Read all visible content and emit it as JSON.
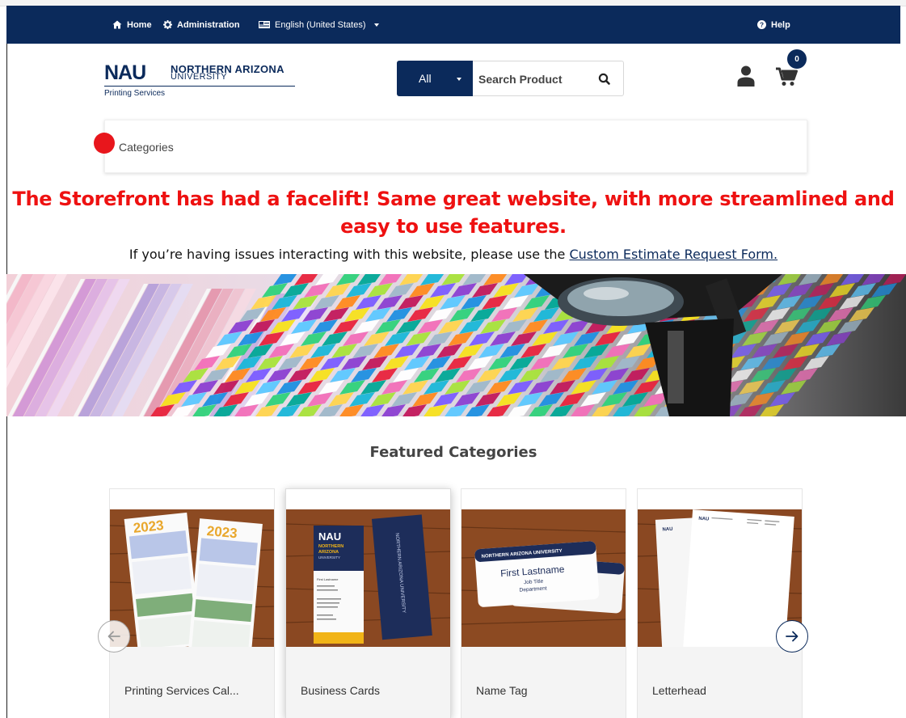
{
  "nav": {
    "home": "Home",
    "administration": "Administration",
    "language": "English (United States)",
    "help": "Help"
  },
  "logo": {
    "mark": "NAU",
    "line1": "NORTHERN ARIZONA",
    "line2": "UNIVERSITY",
    "subtitle": "Printing Services"
  },
  "search": {
    "category": "All",
    "placeholder": "Search Product"
  },
  "cart": {
    "count": "0"
  },
  "categories_label": "Categories",
  "announcement": "The Storefront has had a facelift! Same great website, with more streamlined and easy to use features.",
  "issue": {
    "text": "If you’re having issues interacting with this website, please use the",
    "link": "Custom Estimate Request Form."
  },
  "featured": {
    "title": "Featured Categories",
    "cards": [
      {
        "label": "Printing Services Cal..."
      },
      {
        "label": "Business Cards"
      },
      {
        "label": "Name Tag"
      },
      {
        "label": "Letterhead"
      }
    ]
  },
  "card_art": {
    "calendar_year": "2023",
    "bc_logo": "NAU",
    "bc_line1": "NORTHERN",
    "bc_line2": "ARIZONA",
    "bc_line3": "UNIVERSITY",
    "bc_name": "First Lastname",
    "bc_vertical": "NORTHERN ARIZONA UNIVERSITY",
    "tag_header": "NORTHERN ARIZONA UNIVERSITY",
    "tag_name": "First Lastname",
    "tag_title": "Job Title",
    "tag_dept": "Department",
    "lh_logo": "NAU"
  },
  "colors": {
    "navy": "#0b2a5b",
    "announcement_red": "#ee1111",
    "category_dot": "#e8161c"
  },
  "icons": {
    "home": "home-icon",
    "admin": "cog-icon",
    "language": "flag-icon",
    "help": "question-circle-icon",
    "search": "search-icon",
    "user": "user-icon",
    "cart": "cart-icon",
    "prev": "arrow-left-icon",
    "next": "arrow-right-icon"
  }
}
